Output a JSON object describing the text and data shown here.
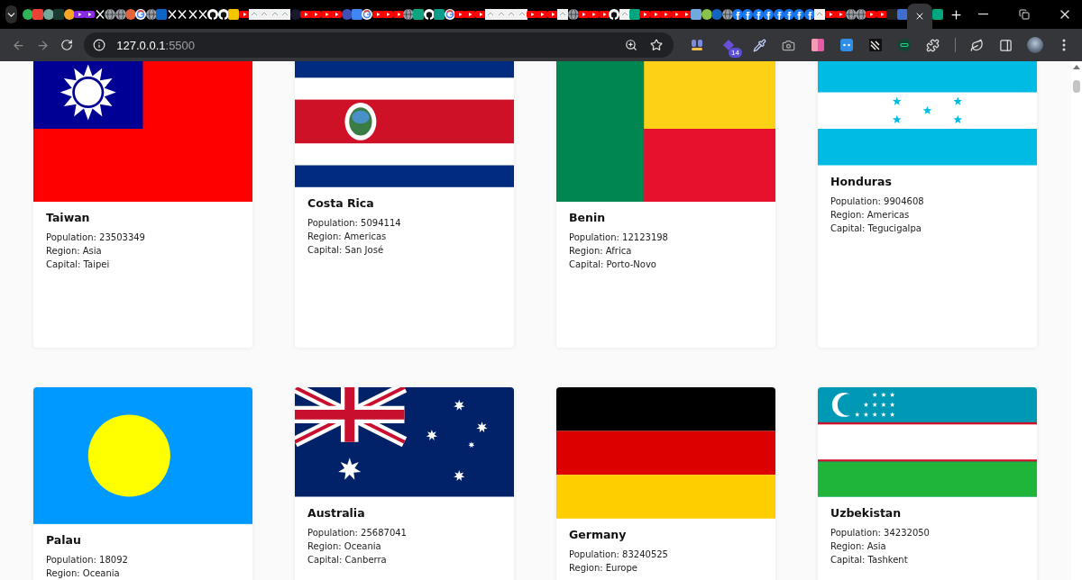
{
  "tabs": [
    {
      "kind": "dot",
      "color": "#2fb45a",
      "selected": false
    },
    {
      "kind": "square",
      "color": "#ea4335",
      "selected": false
    },
    {
      "kind": "dot",
      "color": "#74aa9c",
      "selected": false
    },
    {
      "kind": "square",
      "color": "#1b3a2f",
      "selected": false
    },
    {
      "kind": "dot",
      "color": "#f5a623",
      "selected": false
    },
    {
      "kind": "video",
      "color": "#8a2be2",
      "selected": false
    },
    {
      "kind": "video",
      "color": "#8a2be2",
      "selected": false
    },
    {
      "kind": "x",
      "selected": false
    },
    {
      "kind": "globe",
      "selected": false
    },
    {
      "kind": "globe",
      "selected": false
    },
    {
      "kind": "dot",
      "color": "#e2653a",
      "selected": false
    },
    {
      "kind": "google",
      "selected": false
    },
    {
      "kind": "globe",
      "selected": false
    },
    {
      "kind": "square",
      "color": "#0a66c2",
      "selected": false
    },
    {
      "kind": "x",
      "selected": false
    },
    {
      "kind": "x",
      "selected": false
    },
    {
      "kind": "x",
      "selected": false
    },
    {
      "kind": "x",
      "selected": false
    },
    {
      "kind": "github",
      "selected": false
    },
    {
      "kind": "github",
      "selected": false
    },
    {
      "kind": "square",
      "color": "#f5c400",
      "selected": false
    },
    {
      "kind": "video",
      "color": "#ff0000",
      "selected": false
    },
    {
      "kind": "page",
      "selected": false
    },
    {
      "kind": "page",
      "selected": false
    },
    {
      "kind": "page",
      "selected": false
    },
    {
      "kind": "page",
      "selected": false
    },
    {
      "kind": "dot",
      "color": "#1a1a2e",
      "selected": false
    },
    {
      "kind": "video",
      "color": "#ff0000",
      "selected": false
    },
    {
      "kind": "video",
      "color": "#ff0000",
      "selected": false
    },
    {
      "kind": "video",
      "color": "#ff0000",
      "selected": false
    },
    {
      "kind": "video",
      "color": "#ff0000",
      "selected": false
    },
    {
      "kind": "dot",
      "color": "#3f51b5",
      "selected": false
    },
    {
      "kind": "square",
      "color": "#4285f4",
      "selected": false
    },
    {
      "kind": "google",
      "selected": false
    },
    {
      "kind": "video",
      "color": "#ff0000",
      "selected": false
    },
    {
      "kind": "video",
      "color": "#ff0000",
      "selected": false
    },
    {
      "kind": "video",
      "color": "#ff0000",
      "selected": false
    },
    {
      "kind": "globe",
      "selected": false
    },
    {
      "kind": "square",
      "color": "#10a37f",
      "selected": false
    },
    {
      "kind": "github",
      "selected": false
    },
    {
      "kind": "square",
      "color": "#0f9d8a",
      "selected": false
    },
    {
      "kind": "google",
      "selected": false
    },
    {
      "kind": "video",
      "color": "#ff0000",
      "selected": false
    },
    {
      "kind": "video",
      "color": "#ff0000",
      "selected": false
    },
    {
      "kind": "video",
      "color": "#ff0000",
      "selected": false
    },
    {
      "kind": "page",
      "selected": false
    },
    {
      "kind": "page",
      "selected": false
    },
    {
      "kind": "page",
      "selected": false
    },
    {
      "kind": "page",
      "selected": false
    },
    {
      "kind": "video",
      "color": "#ff0000",
      "selected": false
    },
    {
      "kind": "video",
      "color": "#ff0000",
      "selected": false
    },
    {
      "kind": "video",
      "color": "#ff0000",
      "selected": false
    },
    {
      "kind": "page",
      "selected": false
    },
    {
      "kind": "globe",
      "selected": false
    },
    {
      "kind": "video",
      "color": "#ff0000",
      "selected": false
    },
    {
      "kind": "video",
      "color": "#ff0000",
      "selected": false
    },
    {
      "kind": "video",
      "color": "#ff0000",
      "selected": false
    },
    {
      "kind": "github",
      "selected": false
    },
    {
      "kind": "page",
      "selected": false
    },
    {
      "kind": "square",
      "color": "#00a67e",
      "selected": false
    },
    {
      "kind": "video",
      "color": "#ff0000",
      "selected": false
    },
    {
      "kind": "video",
      "color": "#ff0000",
      "selected": false
    },
    {
      "kind": "video",
      "color": "#ff0000",
      "selected": false
    },
    {
      "kind": "video",
      "color": "#ff0000",
      "selected": false
    },
    {
      "kind": "video",
      "color": "#ff0000",
      "selected": false
    },
    {
      "kind": "square",
      "color": "#6fa8dc",
      "selected": false
    },
    {
      "kind": "dot",
      "color": "#8bc34a",
      "selected": false
    },
    {
      "kind": "dot",
      "color": "#1565c0",
      "selected": false
    },
    {
      "kind": "globe",
      "selected": false
    },
    {
      "kind": "facebook",
      "selected": false
    },
    {
      "kind": "facebook",
      "selected": false
    },
    {
      "kind": "facebook",
      "selected": false
    },
    {
      "kind": "facebook",
      "selected": false
    },
    {
      "kind": "facebook",
      "selected": false
    },
    {
      "kind": "facebook",
      "selected": false
    },
    {
      "kind": "facebook",
      "selected": false
    },
    {
      "kind": "facebook",
      "selected": false
    },
    {
      "kind": "page",
      "selected": false
    },
    {
      "kind": "video",
      "color": "#ff0000",
      "selected": false
    },
    {
      "kind": "video",
      "color": "#ff0000",
      "selected": false
    },
    {
      "kind": "globe",
      "selected": false
    },
    {
      "kind": "globe",
      "selected": false
    },
    {
      "kind": "video",
      "color": "#ff0000",
      "selected": false
    },
    {
      "kind": "video",
      "color": "#ff0000",
      "selected": false
    },
    {
      "kind": "square",
      "color": "#222222",
      "selected": false
    },
    {
      "kind": "square",
      "color": "#3d6fd1",
      "selected": false
    },
    {
      "selected": true
    },
    {
      "kind": "square",
      "color": "#00a67e",
      "selected": false
    }
  ],
  "address": {
    "host": "127.0.0.1",
    "port": ":5500"
  },
  "extension_badge": "14",
  "countries": [
    {
      "kind": "tw",
      "name": "Taiwan",
      "details": [
        "Population: 23503349",
        "Region: Asia",
        "Capital: Taipei"
      ]
    },
    {
      "kind": "cr",
      "name": "Costa Rica",
      "details": [
        "Population: 5094114",
        "Region: Americas",
        "Capital: San José"
      ]
    },
    {
      "kind": "bj",
      "name": "Benin",
      "details": [
        "Population: 12123198",
        "Region: Africa",
        "Capital: Porto-Novo"
      ]
    },
    {
      "kind": "hn",
      "name": "Honduras",
      "details": [
        "Population: 9904608",
        "Region: Americas",
        "Capital: Tegucigalpa"
      ]
    },
    {
      "kind": "pw",
      "name": "Palau",
      "details": [
        "Population: 18092",
        "Region: Oceania"
      ]
    },
    {
      "kind": "au",
      "name": "Australia",
      "details": [
        "Population: 25687041",
        "Region: Oceania",
        "Capital: Canberra"
      ]
    },
    {
      "kind": "de",
      "name": "Germany",
      "details": [
        "Population: 83240525",
        "Region: Europe"
      ]
    },
    {
      "kind": "uz",
      "name": "Uzbekistan",
      "details": [
        "Population: 34232050",
        "Region: Asia",
        "Capital: Tashkent"
      ]
    }
  ]
}
